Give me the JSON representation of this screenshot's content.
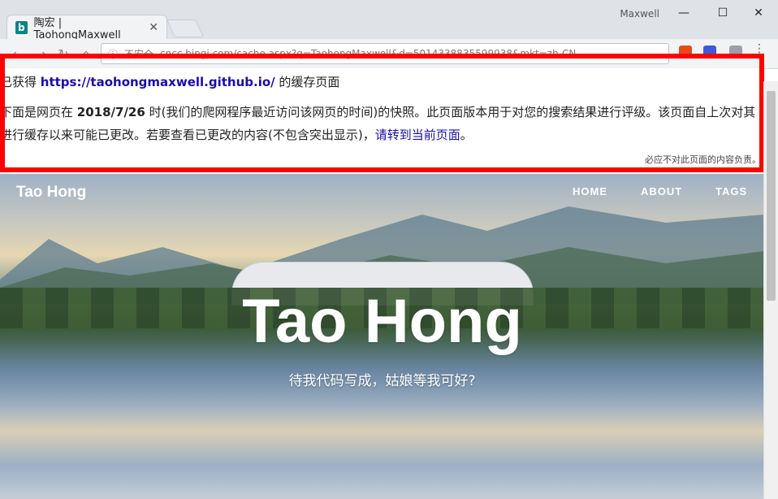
{
  "browser": {
    "tab_title": "陶宏 | TaohongMaxwell",
    "window_title": "Maxwell",
    "url_security": "不安全",
    "url_text": "cncc.bingj.com/cache.aspx?q=TaohongMaxwell&d=5014338835599938&mkt=zh-CN"
  },
  "cache_notice": {
    "prefix": "已获得 ",
    "url": "https://taohongmaxwell.github.io/",
    "suffix": " 的缓存页面",
    "line2_part1": "下面是网页在 ",
    "date": "2018/7/26",
    "line2_part2": " 时(我们的爬网程序最近访问该网页的时间)的快照。此页面版本用于对您的搜索结果进行评级。该页面自上次对其进行缓存以来可能已更改。若要查看已更改的内容(不包含突出显示)，",
    "current_link": "请转到当前页面",
    "line2_end": "。",
    "disclaimer": "必应不对此页面的内容负责。"
  },
  "site": {
    "brand": "Tao Hong",
    "nav": [
      "HOME",
      "ABOUT",
      "TAGS"
    ],
    "hero_title": "Tao Hong",
    "hero_subtitle": "待我代码写成，姑娘等我可好?"
  },
  "colors": {
    "highlight": "#ff0000",
    "link": "#1a0dab"
  }
}
